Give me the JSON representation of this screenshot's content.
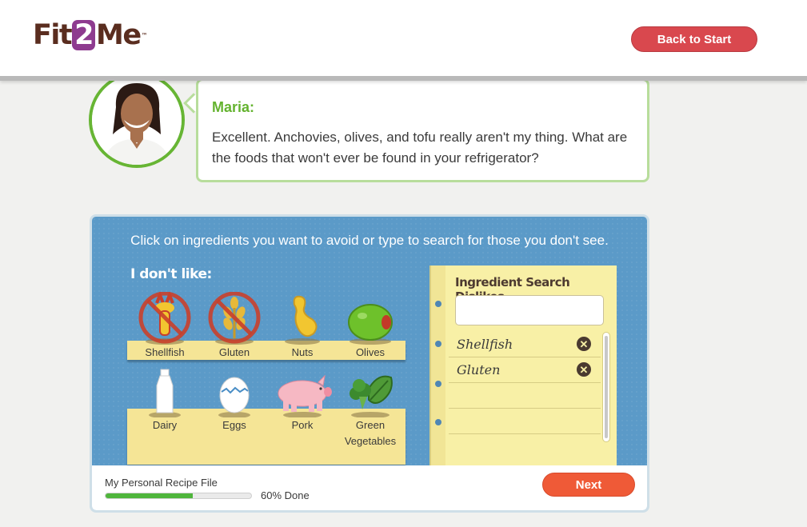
{
  "header": {
    "logo_part1": "Fit",
    "logo_part2": "2",
    "logo_part3": "Me",
    "logo_tm": "™",
    "back_button": "Back to Start"
  },
  "dialog": {
    "speaker": "Maria:",
    "message": "Excellent. Anchovies, olives, and tofu really aren't my thing. What are the foods that won't ever be found in your refrigerator?"
  },
  "panel": {
    "instruction": "Click on ingredients you want to avoid or type to search for those you don't see.",
    "dont_like_label": "I don't like:",
    "ingredients": [
      {
        "label": "Shellfish",
        "icon": "shellfish-icon",
        "selected": true
      },
      {
        "label": "Gluten",
        "icon": "gluten-icon",
        "selected": true
      },
      {
        "label": "Nuts",
        "icon": "nuts-icon",
        "selected": false
      },
      {
        "label": "Olives",
        "icon": "olive-icon",
        "selected": false
      },
      {
        "label": "Dairy",
        "icon": "milk-icon",
        "selected": false
      },
      {
        "label": "Eggs",
        "icon": "egg-icon",
        "selected": false
      },
      {
        "label": "Pork",
        "icon": "pig-icon",
        "selected": false
      },
      {
        "label": "Green Vegetables",
        "icon": "vegetables-icon",
        "selected": false
      }
    ]
  },
  "notepad": {
    "title": "Ingredient Search Dislikes",
    "search_value": "",
    "dislikes": [
      "Shellfish",
      "Gluten"
    ],
    "remove_glyph": "✕"
  },
  "footer": {
    "progress_title": "My Personal Recipe File",
    "progress_percent": 60,
    "progress_text": "60% Done",
    "next_button": "Next"
  },
  "colors": {
    "brand_purple": "#8e3b8f",
    "brand_brown": "#5a2d1f",
    "accent_green": "#64b32f",
    "back_button_red": "#d9484e",
    "next_button_orange": "#ef5a37",
    "panel_blue": "#5b9ac8",
    "notepad_yellow": "#f8f0a6"
  }
}
